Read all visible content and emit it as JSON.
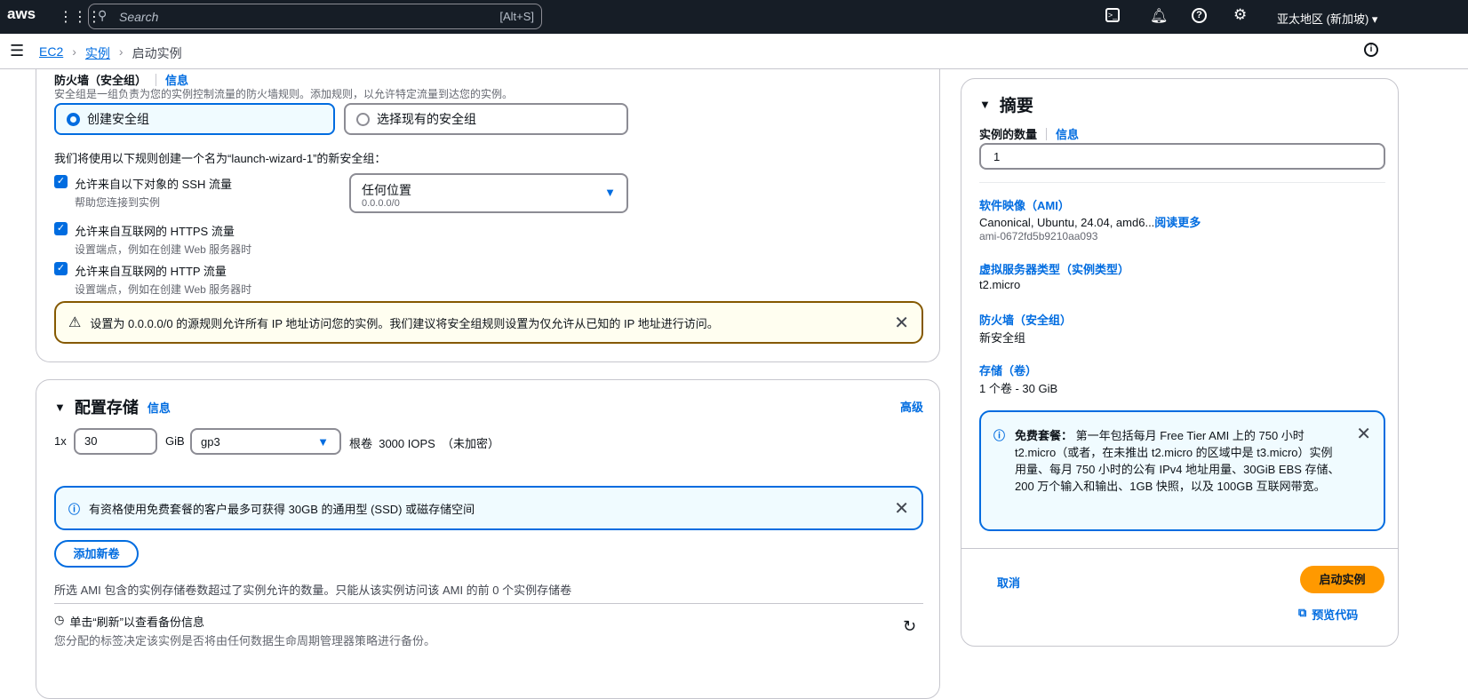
{
  "topbar": {
    "logo": "aws",
    "search_placeholder": "Search",
    "search_shortcut": "[Alt+S]",
    "region": "亚太地区 (新加坡)"
  },
  "breadcrumb": [
    "EC2",
    "实例",
    "启动实例"
  ],
  "firewall": {
    "title": "防火墙（安全组）",
    "info": "信息",
    "desc": "安全组是一组负责为您的实例控制流量的防火墙规则。添加规则，以允许特定流量到达您的实例。",
    "create": "创建安全组",
    "select_existing": "选择现有的安全组",
    "rule_intro": "我们将使用以下规则创建一个名为“launch-wizard-1”的新安全组：",
    "rules": [
      {
        "label": "允许来自以下对象的 SSH 流量",
        "sub": "帮助您连接到实例"
      },
      {
        "label": "允许来自互联网的 HTTPS 流量",
        "sub": "设置端点，例如在创建 Web 服务器时"
      },
      {
        "label": "允许来自互联网的 HTTP 流量",
        "sub": "设置端点，例如在创建 Web 服务器时"
      }
    ],
    "source_select": {
      "value": "任何位置",
      "sub": "0.0.0.0/0"
    },
    "warning": "设置为 0.0.0.0/0 的源规则允许所有 IP 地址访问您的实例。我们建议将安全组规则设置为仅允许从已知的 IP 地址进行访问。"
  },
  "storage": {
    "title": "配置存储",
    "info": "信息",
    "advanced": "高级",
    "multiplier": "1x",
    "size": "30",
    "unit": "GiB",
    "type": "gp3",
    "desc": "根卷  3000 IOPS  （未加密）",
    "info_alert": "有资格使用免费套餐的客户最多可获得 30GB 的通用型 (SSD) 或磁存储空间",
    "add_volume": "添加新卷",
    "note": "所选 AMI 包含的实例存储卷数超过了实例允许的数量。只能从该实例访问该 AMI 的前 0 个实例存储卷",
    "backup_title": "单击“刷新”以查看备份信息",
    "backup_desc": "您分配的标签决定该实例是否将由任何数据生命周期管理器策略进行备份。"
  },
  "summary": {
    "title": "摘要",
    "count_label": "实例的数量",
    "info": "信息",
    "count": "1",
    "ami_label": "软件映像（AMI）",
    "ami_value": "Canonical, Ubuntu, 24.04, amd6...",
    "read_more": "阅读更多",
    "ami_id": "ami-0672fd5b9210aa093",
    "type_label": "虚拟服务器类型（实例类型）",
    "type_value": "t2.micro",
    "fw_label": "防火墙（安全组）",
    "fw_value": "新安全组",
    "storage_label": "存储（卷）",
    "storage_value": "1 个卷 - 30 GiB",
    "free_title": "免费套餐：",
    "free_text": "第一年包括每月 Free Tier AMI 上的 750 小时 t2.micro（或者，在未推出 t2.micro 的区域中是 t3.micro）实例用量、每月 750 小时的公有 IPv4 地址用量、30GiB EBS 存储、200 万个输入和输出、1GB 快照，以及 100GB 互联网带宽。",
    "cancel": "取消",
    "launch": "启动实例",
    "preview": "预览代码"
  }
}
